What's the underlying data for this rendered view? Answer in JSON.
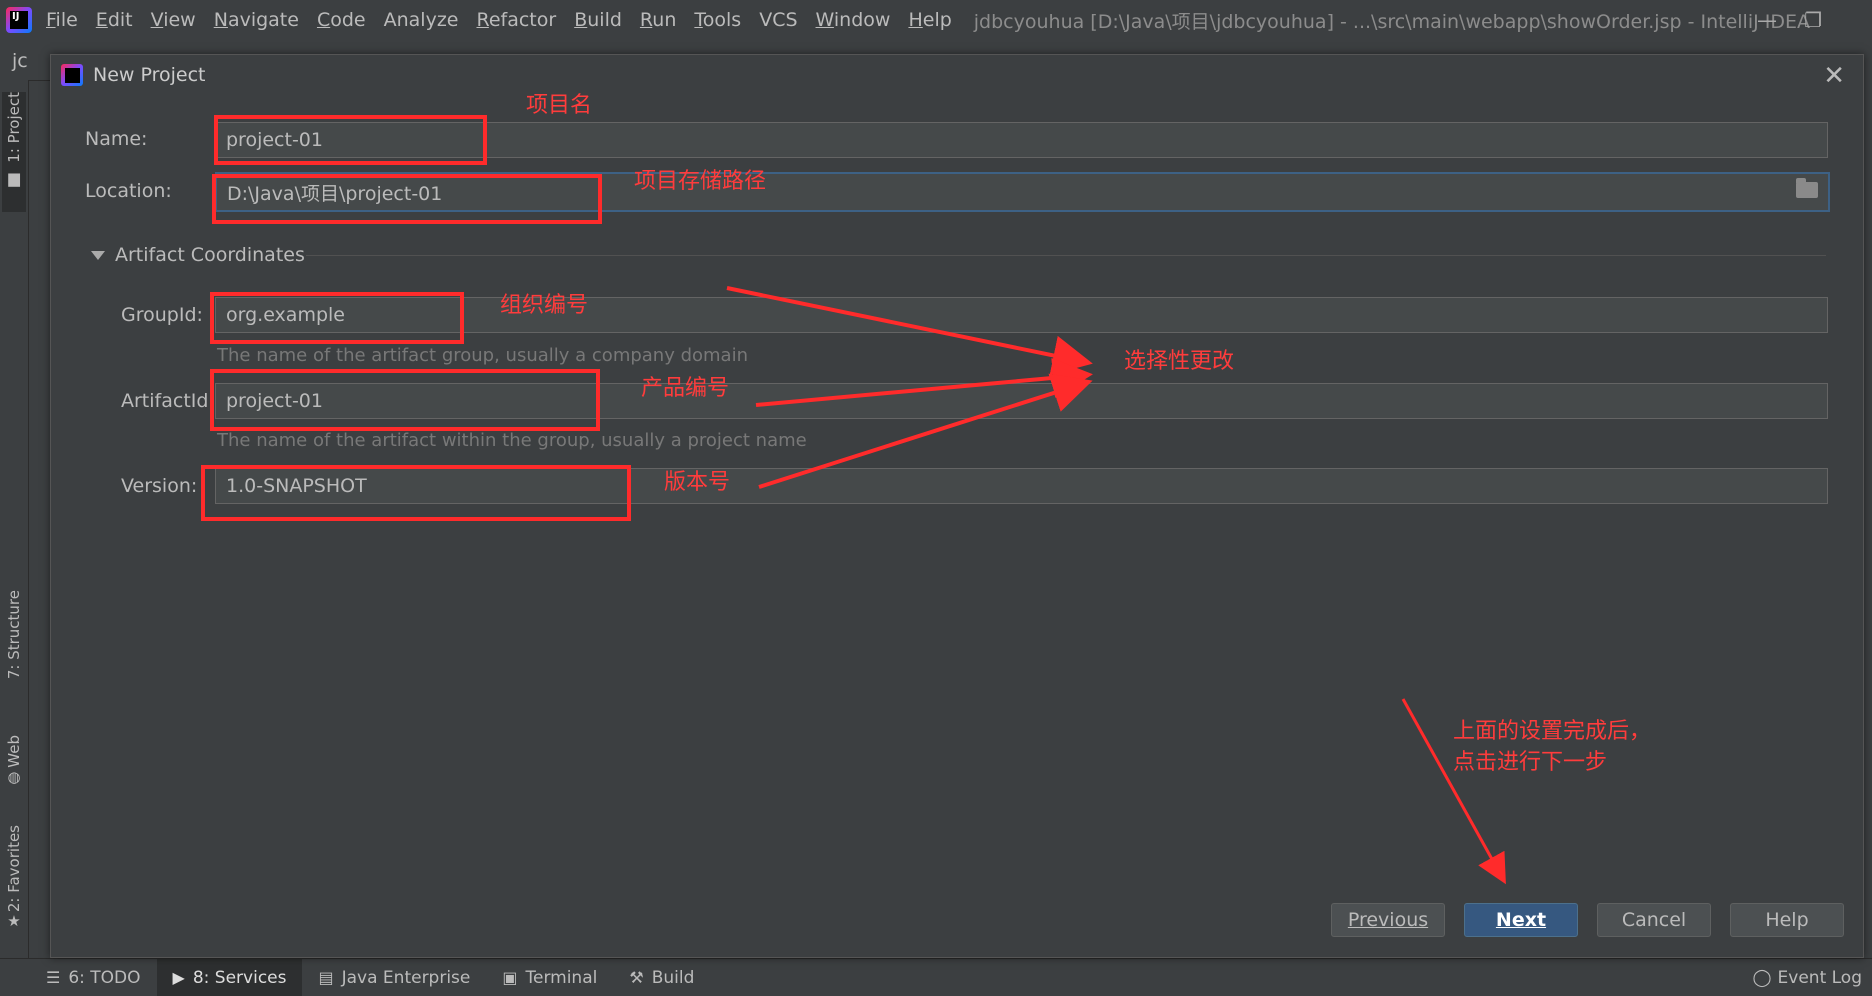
{
  "menubar": {
    "items": [
      {
        "label": "File",
        "mnemonic": "F",
        "rest": "ile"
      },
      {
        "label": "Edit",
        "mnemonic": "E",
        "rest": "dit"
      },
      {
        "label": "View",
        "mnemonic": "V",
        "rest": "iew"
      },
      {
        "label": "Navigate",
        "mnemonic": "N",
        "rest": "avigate"
      },
      {
        "label": "Code",
        "mnemonic": "C",
        "rest": "ode"
      },
      {
        "label": "Analyze",
        "mnemonic": "",
        "rest": "Analyze"
      },
      {
        "label": "Refactor",
        "mnemonic": "R",
        "rest": "efactor"
      },
      {
        "label": "Build",
        "mnemonic": "B",
        "rest": "uild"
      },
      {
        "label": "Run",
        "mnemonic": "R",
        "rest": "un"
      },
      {
        "label": "Tools",
        "mnemonic": "T",
        "rest": "ools"
      },
      {
        "label": "VCS",
        "mnemonic": "",
        "rest": "VCS"
      },
      {
        "label": "Window",
        "mnemonic": "W",
        "rest": "indow"
      },
      {
        "label": "Help",
        "mnemonic": "H",
        "rest": "elp"
      }
    ],
    "window_title": "jdbcyouhua [D:\\Java\\项目\\jdbcyouhua] - ...\\src\\main\\webapp\\showOrder.jsp - IntelliJ IDEA"
  },
  "toolbar": {
    "breadcrumb": "jc"
  },
  "left_tabs": {
    "project": "1: Project",
    "structure": "7: Structure",
    "web": "Web",
    "favorites": "2: Favorites"
  },
  "bottom_bar": {
    "todo": "6: TODO",
    "services": "8: Services",
    "java_enterprise": "Java Enterprise",
    "terminal": "Terminal",
    "build": "Build",
    "event_log": "Event Log"
  },
  "dialog": {
    "title": "New Project",
    "name_label": "Name:",
    "name_value": "project-01",
    "location_label": "Location:",
    "location_value": "D:\\Java\\项目\\project-01",
    "section_title": "Artifact Coordinates",
    "groupid_label": "GroupId:",
    "groupid_value": "org.example",
    "groupid_hint": "The name of the artifact group, usually a company domain",
    "artifactid_label": "ArtifactId:",
    "artifactid_value": "project-01",
    "artifactid_hint": "The name of the artifact within the group, usually a project name",
    "version_label": "Version:",
    "version_value": "1.0-SNAPSHOT",
    "buttons": {
      "previous": "Previous",
      "next": "Next",
      "cancel": "Cancel",
      "help": "Help"
    }
  },
  "annotations": {
    "project_name": "项目名",
    "storage_path": "项目存储路径",
    "org_number": "组织编号",
    "product_number": "产品编号",
    "version_number": "版本号",
    "optional_change": "选择性更改",
    "after_setup_line1": "上面的设置完成后，",
    "after_setup_line2": "点击进行下一步"
  },
  "colors": {
    "annotation_red": "#ff2b2b",
    "primary_button": "#365880",
    "background": "#3c3f41"
  }
}
